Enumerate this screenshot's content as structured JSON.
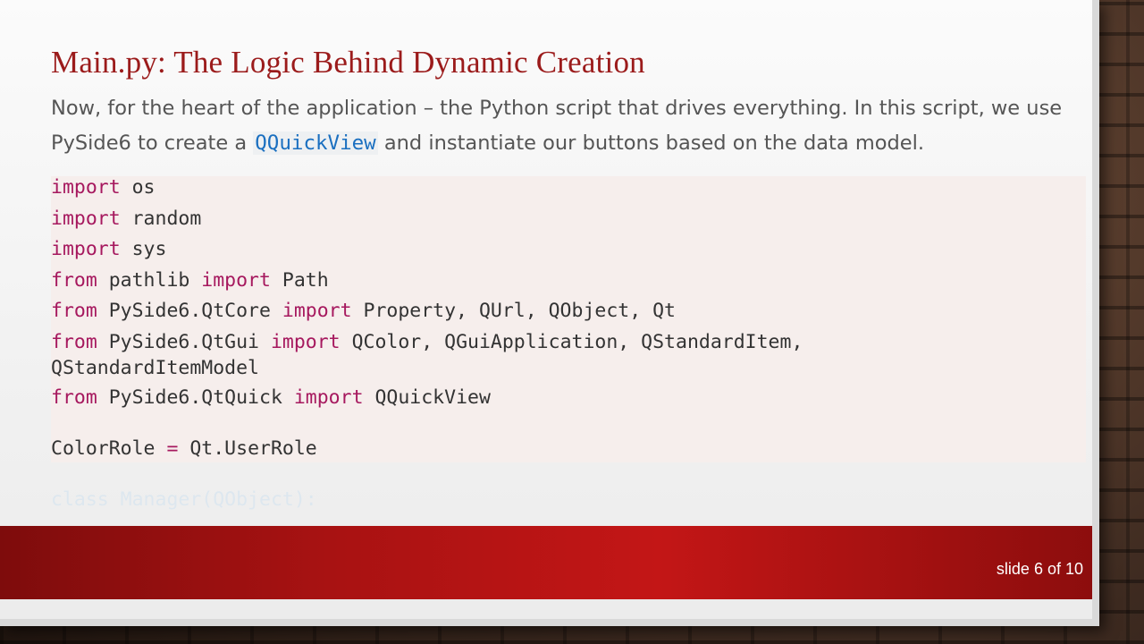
{
  "slide": {
    "title": "Main.py: The Logic Behind Dynamic Creation",
    "body_part1": "Now, for the heart of the application – the Python script that drives everything. In this script, we use PySide6 to create a ",
    "body_code": "QQuickView",
    "body_part2": " and instantiate our buttons based on the data model.",
    "code": {
      "l1_kw": "import",
      "l1_rest": " os",
      "l2_kw": "import",
      "l2_rest": " random",
      "l3_kw": "import",
      "l3_rest": " sys",
      "l4_kw1": "from",
      "l4_mid": " pathlib ",
      "l4_kw2": "import",
      "l4_rest": " Path",
      "l5_kw1": "from",
      "l5_mid": " PySide6.QtCore ",
      "l5_kw2": "import",
      "l5_rest": " Property, QUrl, QObject, Qt",
      "l6_kw1": "from",
      "l6_mid": " PySide6.QtGui ",
      "l6_kw2": "import",
      "l6_rest": " QColor, QGuiApplication, QStandardItem,",
      "l6_cont": "QStandardItemModel",
      "l7_kw1": "from",
      "l7_mid": " PySide6.QtQuick ",
      "l7_kw2": "import",
      "l7_rest": " QQuickView",
      "l8_a": "ColorRole ",
      "l8_op": "=",
      "l8_b": " Qt.UserRole",
      "faded": "class Manager(QObject):"
    },
    "slide_number": "slide 6 of 10"
  },
  "colors": {
    "title": "#9b1b1b",
    "keyword": "#a6185e",
    "inline_code": "#1a6fc0",
    "footer": "#b41414"
  }
}
